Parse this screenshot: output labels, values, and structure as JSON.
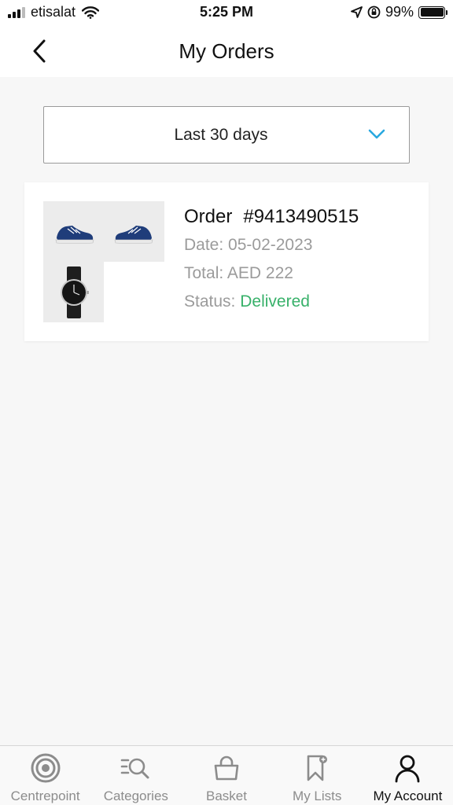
{
  "status_bar": {
    "carrier": "etisalat",
    "time": "5:25 PM",
    "battery": "99%"
  },
  "header": {
    "title": "My Orders"
  },
  "filter": {
    "selected": "Last 30 days"
  },
  "order": {
    "label": "Order",
    "number": "#9413490515",
    "date_label": "Date:",
    "date": "05-02-2023",
    "total_label": "Total:",
    "total": "AED 222",
    "status_label": "Status:",
    "status": "Delivered"
  },
  "colors": {
    "delivered": "#38b16a",
    "chevron": "#29a8e0"
  },
  "tabs": [
    {
      "label": "Centrepoint",
      "icon": "target-icon"
    },
    {
      "label": "Categories",
      "icon": "categories-search-icon"
    },
    {
      "label": "Basket",
      "icon": "basket-icon"
    },
    {
      "label": "My Lists",
      "icon": "bookmark-icon"
    },
    {
      "label": "My Account",
      "icon": "user-icon"
    }
  ]
}
